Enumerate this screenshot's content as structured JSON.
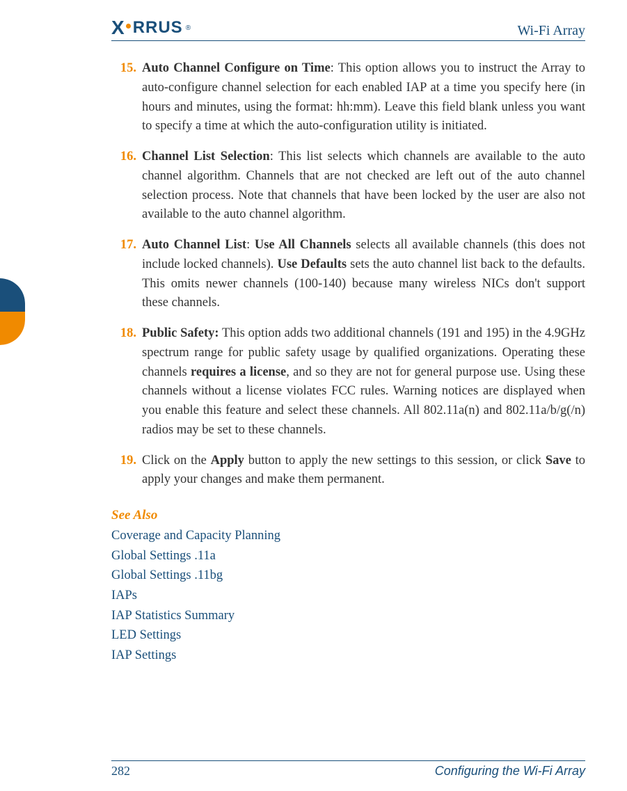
{
  "header": {
    "logo_text_1": "X",
    "logo_text_2": "RRUS",
    "title": "Wi-Fi Array"
  },
  "steps": [
    {
      "num": "15.",
      "lead": "Auto Channel Configure on Time",
      "sep": ": ",
      "body": "This option allows you to instruct the Array to auto-configure channel selection for each enabled IAP at a time you specify here (in hours and minutes, using the format: hh:mm). Leave this field blank unless you want to specify a time at which the auto-configuration utility is initiated."
    },
    {
      "num": "16.",
      "lead": "Channel List Selection",
      "sep": ": ",
      "body": "This list selects which channels are available to the auto channel algorithm. Channels that are not checked are left out of the auto channel selection process. Note that channels that have been locked by the user are also not available to the auto channel algorithm."
    },
    {
      "num": "17.",
      "lead": "Auto Channel List",
      "sep": ": ",
      "bold2": "Use All Channels",
      "mid1": " selects all available channels (this does not include locked channels). ",
      "bold3": "Use Defaults",
      "mid2": " sets the auto channel list back to the defaults. This omits newer channels (100-140) because many wireless NICs don't support these channels."
    },
    {
      "num": "18.",
      "lead": "Public Safety:",
      "sep": " ",
      "pre": "This option adds two additional channels (191 and 195) in the 4.9GHz spectrum range for public safety usage by qualified organizations. Operating these channels ",
      "bold2": "requires a license",
      "mid1": ", and so they are not for general purpose use. Using these channels without a license violates FCC rules. Warning notices are displayed when you enable this feature and select these channels. All 802.11a(n) and 802.11a/b/g(/n) radios may be set to these channels."
    },
    {
      "num": "19.",
      "pre": "Click on the ",
      "bold2": "Apply",
      "mid1": " button to apply the new settings to this session, or click ",
      "bold3": "Save",
      "mid2": " to apply your changes and make them permanent."
    }
  ],
  "see_also": {
    "title": "See Also",
    "links": [
      "Coverage and Capacity Planning",
      "Global Settings .11a",
      "Global Settings .11bg",
      "IAPs",
      "IAP Statistics Summary",
      "LED Settings",
      "IAP Settings"
    ]
  },
  "footer": {
    "page_number": "282",
    "section_title": "Configuring the Wi-Fi Array"
  }
}
